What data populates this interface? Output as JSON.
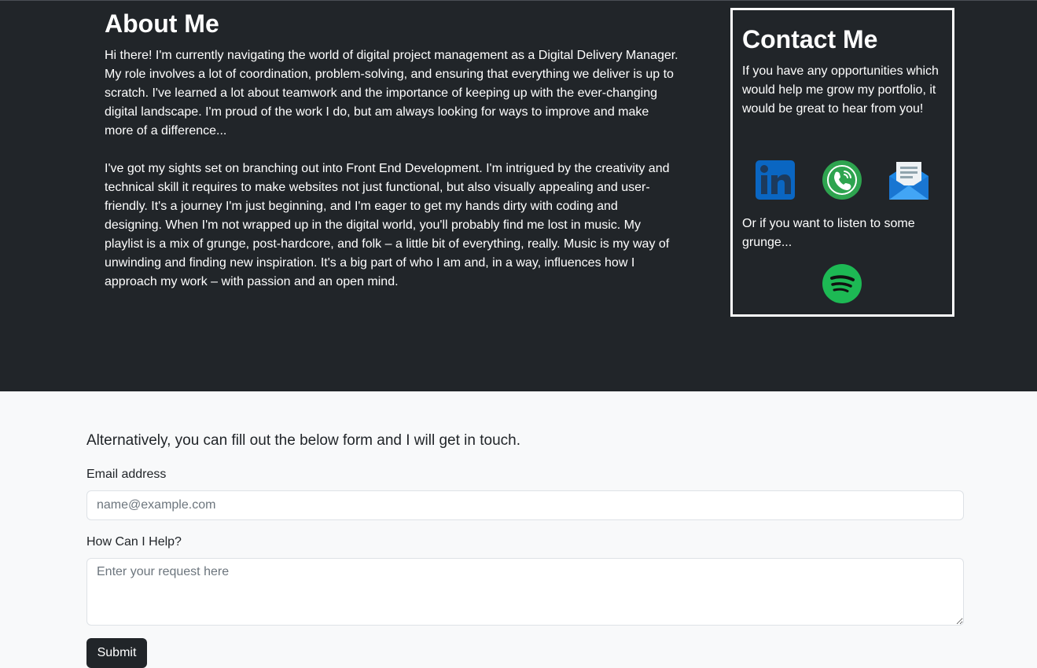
{
  "about": {
    "title": "About Me",
    "paragraph1": "Hi there! I'm currently navigating the world of digital project management as a Digital Delivery Manager. My role involves a lot of coordination, problem-solving, and ensuring that everything we deliver is up to scratch. I've learned a lot about teamwork and the importance of keeping up with the ever-changing digital landscape. I'm proud of the work I do, but am always looking for ways to improve and make more of a difference...",
    "paragraph2": "I've got my sights set on branching out into Front End Development. I'm intrigued by the creativity and technical skill it requires to make websites not just functional, but also visually appealing and user-friendly. It's a journey I'm just beginning, and I'm eager to get my hands dirty with coding and designing. When I'm not wrapped up in the digital world, you'll probably find me lost in music. My playlist is a mix of grunge, post-hardcore, and folk – a little bit of everything, really. Music is my way of unwinding and finding new inspiration. It's a big part of who I am and, in a way, influences how I approach my work – with passion and an open mind."
  },
  "contact": {
    "title": "Contact Me",
    "intro": "If you have any opportunities which would help me grow my portfolio, it would be great to hear from you!",
    "outro": "Or if you want to listen to some grunge...",
    "icons": [
      "linkedin-icon",
      "phone-icon",
      "email-icon",
      "spotify-icon"
    ]
  },
  "form": {
    "lead": "Alternatively, you can fill out the below form and I will get in touch.",
    "email_label": "Email address",
    "email_placeholder": "name@example.com",
    "help_label": "How Can I Help?",
    "help_placeholder": "Enter your request here",
    "submit_label": "Submit"
  },
  "colors": {
    "dark_bg": "#212529",
    "light_bg": "#f8f9fa",
    "linkedin": "#0a66c2",
    "phone": "#2ea44f",
    "mail": "#1e88e5",
    "spotify": "#1ed760"
  }
}
